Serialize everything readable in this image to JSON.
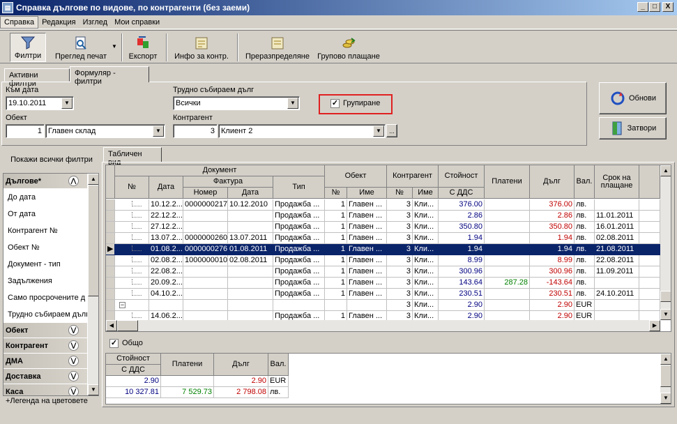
{
  "window": {
    "title": "Справка дългове по видове, по контрагенти (без заеми)",
    "min": "_",
    "max": "□",
    "close": "X"
  },
  "menu": [
    "Справка",
    "Редакция",
    "Изглед",
    "Мои справки"
  ],
  "toolbar": {
    "filters": "Филтри",
    "preview": "Преглед печат",
    "export": "Експорт",
    "info": "Инфо за контр.",
    "redistribute": "Преразпределяне",
    "group_pay": "Групово плащане"
  },
  "tabs": {
    "active": "Активни филтри",
    "form": "Формуляр - филтри"
  },
  "form": {
    "date_label": "Към дата",
    "date_value": "19.10.2011",
    "hard_label": "Трудно събираем дълг",
    "hard_value": "Всички",
    "grouping_label": "Групиране",
    "object_label": "Обект",
    "object_num": "1",
    "object_name": "Главен склад",
    "contractor_label": "Контрагент",
    "contractor_num": "3",
    "contractor_name": "Клиент 2",
    "browse": "..."
  },
  "buttons": {
    "refresh": "Обнови",
    "close": "Затвори"
  },
  "sidebar": {
    "show_all": "Покажи всички филтри",
    "debts_header": "Дългове*",
    "debt_items": [
      "До дата",
      "От дата",
      "Контрагент №",
      "Обект №",
      "Документ - тип",
      "Задължения",
      "Само просрочените д",
      "Трудно събираем дълг"
    ],
    "sections": [
      "Обект",
      "Контрагент",
      "ДМА",
      "Доставка",
      "Каса"
    ],
    "legend": "+Легенда на цветовете"
  },
  "table_tab": "Табличен вид",
  "table_headers": {
    "document": "Документ",
    "num": "№",
    "date": "Дата",
    "invoice": "Фактура",
    "inv_num": "Номер",
    "inv_date": "Дата",
    "type": "Тип",
    "object": "Обект",
    "obj_num": "№",
    "obj_name": "Име",
    "contractor": "Контрагент",
    "c_num": "№",
    "c_name": "Име",
    "value": "Стойност",
    "value_sub": "С ДДС",
    "paid": "Платени",
    "debt": "Дълг",
    "cur": "Вал.",
    "term": "Срок на плащане"
  },
  "rows": [
    {
      "date": "10.12.2...",
      "inv_num": "0000000217",
      "inv_date": "10.12.2010",
      "type": "Продажба ...",
      "obj_num": "1",
      "obj_name": "Главен ...",
      "c_num": "3",
      "c_name": "Кли...",
      "value": "376.00",
      "paid": "",
      "debt": "376.00",
      "cur": "лв.",
      "term": ""
    },
    {
      "date": "22.12.2...",
      "inv_num": "",
      "inv_date": "",
      "type": "Продажба ...",
      "obj_num": "1",
      "obj_name": "Главен ...",
      "c_num": "3",
      "c_name": "Кли...",
      "value": "2.86",
      "paid": "",
      "debt": "2.86",
      "cur": "лв.",
      "term": "11.01.2011"
    },
    {
      "date": "27.12.2...",
      "inv_num": "",
      "inv_date": "",
      "type": "Продажба ...",
      "obj_num": "1",
      "obj_name": "Главен ...",
      "c_num": "3",
      "c_name": "Кли...",
      "value": "350.80",
      "paid": "",
      "debt": "350.80",
      "cur": "лв.",
      "term": "16.01.2011"
    },
    {
      "date": "13.07.2...",
      "inv_num": "0000000260",
      "inv_date": "13.07.2011",
      "type": "Продажба ...",
      "obj_num": "1",
      "obj_name": "Главен ...",
      "c_num": "3",
      "c_name": "Кли...",
      "value": "1.94",
      "paid": "",
      "debt": "1.94",
      "cur": "лв.",
      "term": "02.08.2011"
    },
    {
      "date": "01.08.2...",
      "inv_num": "0000000276",
      "inv_date": "01.08.2011",
      "type": "Продажба ...",
      "obj_num": "1",
      "obj_name": "Главен ...",
      "c_num": "3",
      "c_name": "Кли...",
      "value": "1.94",
      "paid": "",
      "debt": "1.94",
      "cur": "лв.",
      "term": "21.08.2011"
    },
    {
      "date": "02.08.2...",
      "inv_num": "1000000010",
      "inv_date": "02.08.2011",
      "type": "Продажба ...",
      "obj_num": "1",
      "obj_name": "Главен ...",
      "c_num": "3",
      "c_name": "Кли...",
      "value": "8.99",
      "paid": "",
      "debt": "8.99",
      "cur": "лв.",
      "term": "22.08.2011"
    },
    {
      "date": "22.08.2...",
      "inv_num": "",
      "inv_date": "",
      "type": "Продажба ...",
      "obj_num": "1",
      "obj_name": "Главен ...",
      "c_num": "3",
      "c_name": "Кли...",
      "value": "300.96",
      "paid": "",
      "debt": "300.96",
      "cur": "лв.",
      "term": "11.09.2011"
    },
    {
      "date": "20.09.2...",
      "inv_num": "",
      "inv_date": "",
      "type": "Продажба ...",
      "obj_num": "1",
      "obj_name": "Главен ...",
      "c_num": "3",
      "c_name": "Кли...",
      "value": "143.64",
      "paid": "287.28",
      "debt": "-143.64",
      "cur": "лв.",
      "term": ""
    },
    {
      "date": "04.10.2...",
      "inv_num": "",
      "inv_date": "",
      "type": "Продажба ...",
      "obj_num": "1",
      "obj_name": "Главен ...",
      "c_num": "3",
      "c_name": "Кли...",
      "value": "230.51",
      "paid": "",
      "debt": "230.51",
      "cur": "лв.",
      "term": "24.10.2011"
    },
    {
      "date": "",
      "inv_num": "",
      "inv_date": "",
      "type": "",
      "obj_num": "",
      "obj_name": "",
      "c_num": "3",
      "c_name": "Кли...",
      "value": "2.90",
      "paid": "",
      "debt": "2.90",
      "cur": "EUR",
      "term": ""
    },
    {
      "date": "14.06.2...",
      "inv_num": "",
      "inv_date": "",
      "type": "Продажба ...",
      "obj_num": "1",
      "obj_name": "Главен ...",
      "c_num": "3",
      "c_name": "Кли...",
      "value": "2.90",
      "paid": "",
      "debt": "2.90",
      "cur": "EUR",
      "term": ""
    }
  ],
  "total_label": "Общо",
  "totals_headers": {
    "value": "Стойност",
    "value_sub": "С ДДС",
    "paid": "Платени",
    "debt": "Дълг",
    "cur": "Вал."
  },
  "totals": [
    {
      "value": "2.90",
      "paid": "",
      "debt": "2.90",
      "cur": "EUR"
    },
    {
      "value": "10 327.81",
      "paid": "7 529.73",
      "debt": "2 798.08",
      "cur": "лв."
    }
  ]
}
